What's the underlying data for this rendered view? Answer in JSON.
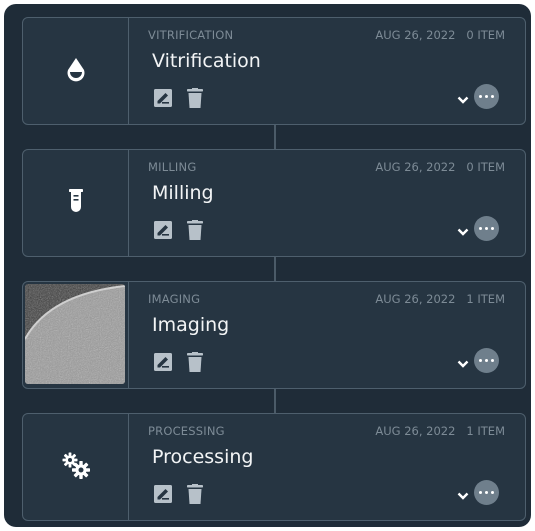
{
  "steps": [
    {
      "category": "VITRIFICATION",
      "title": "Vitrification",
      "date": "AUG 26, 2022",
      "count": "0 ITEM",
      "icon": "droplet-icon"
    },
    {
      "category": "MILLING",
      "title": "Milling",
      "date": "AUG 26, 2022",
      "count": "0 ITEM",
      "icon": "test-tube-icon"
    },
    {
      "category": "IMAGING",
      "title": "Imaging",
      "date": "AUG 26, 2022",
      "count": "1 ITEM",
      "icon": "micrograph-thumbnail"
    },
    {
      "category": "PROCESSING",
      "title": "Processing",
      "date": "AUG 26, 2022",
      "count": "1 ITEM",
      "icon": "gears-icon"
    }
  ],
  "colors": {
    "panel_bg": "#1f2c38",
    "card_bg": "#263542",
    "border": "#4e5f6d",
    "muted_text": "#7d8b96",
    "title_text": "#f2f4f5",
    "more_button": "#6f7f8c"
  }
}
